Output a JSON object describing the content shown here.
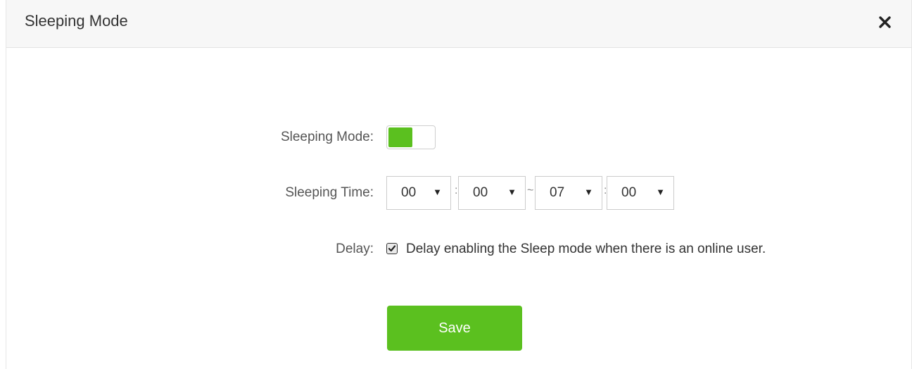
{
  "dialog": {
    "title": "Sleeping Mode"
  },
  "icons": {
    "close": "close-icon",
    "dropdown": "triangle-down-icon",
    "checkmark": "checkmark-icon"
  },
  "colors": {
    "accent": "#5bc01f",
    "header_bg": "#f7f7f7"
  },
  "form": {
    "sleeping_mode": {
      "label": "Sleeping Mode:",
      "enabled": true
    },
    "sleeping_time": {
      "label": "Sleeping Time:",
      "start_hour": "00",
      "start_minute": "00",
      "end_hour": "07",
      "end_minute": "00",
      "time_separator": ":",
      "range_separator": "~"
    },
    "delay": {
      "label": "Delay:",
      "checked": true,
      "text": "Delay enabling the Sleep mode when there is an online user."
    },
    "save_label": "Save"
  }
}
